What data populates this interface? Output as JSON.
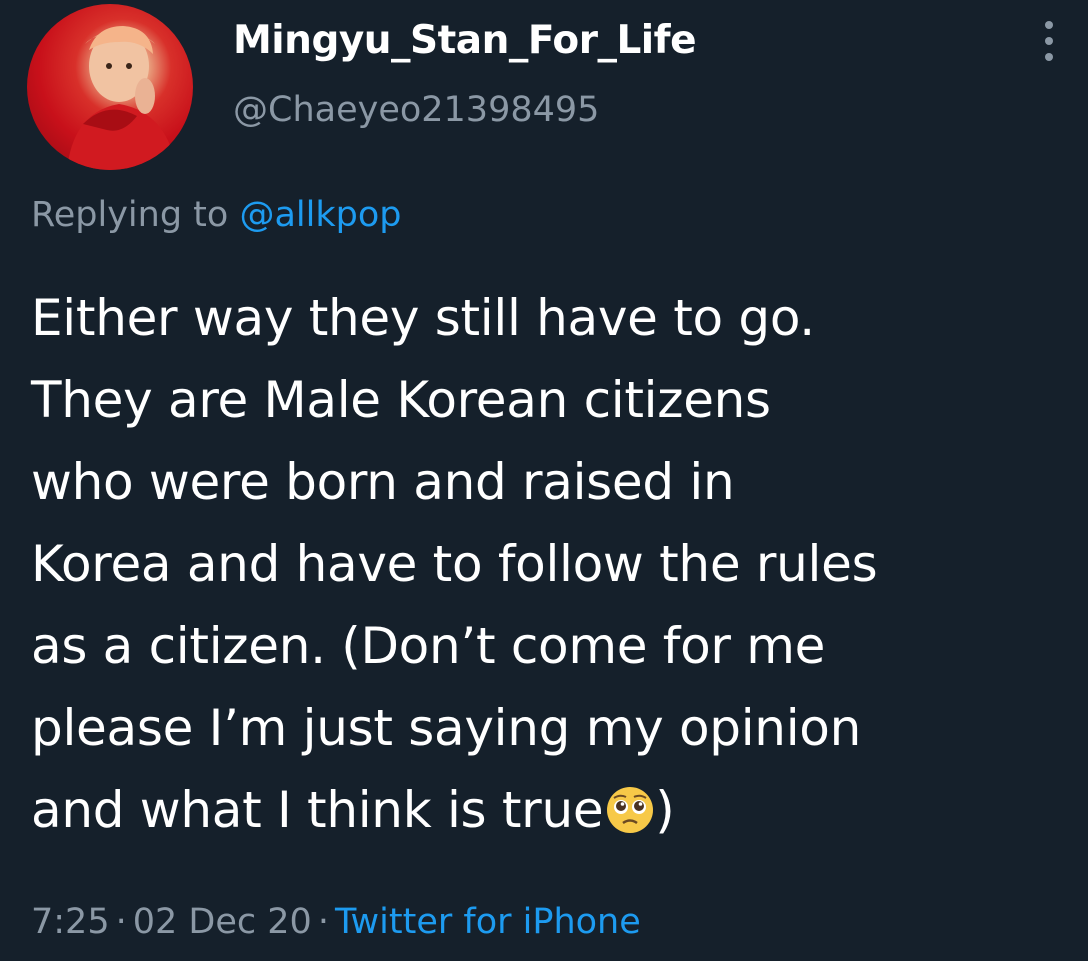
{
  "user": {
    "display_name": "Mingyu_Stan_For_Life",
    "handle": "@Chaeyeo21398495"
  },
  "more_icon": "vertical-ellipsis-icon",
  "reply": {
    "prefix": "Replying to ",
    "to_handle": "@allkpop"
  },
  "tweet": {
    "lines": [
      "Either way they still have to go.",
      "They are Male Korean citizens",
      "who were born and raised in",
      "Korea and have to follow the rules",
      "as a citizen. (Don’t come for me",
      "please I’m just saying my opinion",
      "and what I think is true"
    ],
    "emoji": "pleading-face-emoji",
    "closing": ")"
  },
  "meta": {
    "time": "7:25",
    "separator": "·",
    "date": "02 Dec 20",
    "source": "Twitter for iPhone"
  },
  "colors": {
    "background": "#15202b",
    "secondary_text": "#8b98a5",
    "link": "#1d9bf0"
  }
}
